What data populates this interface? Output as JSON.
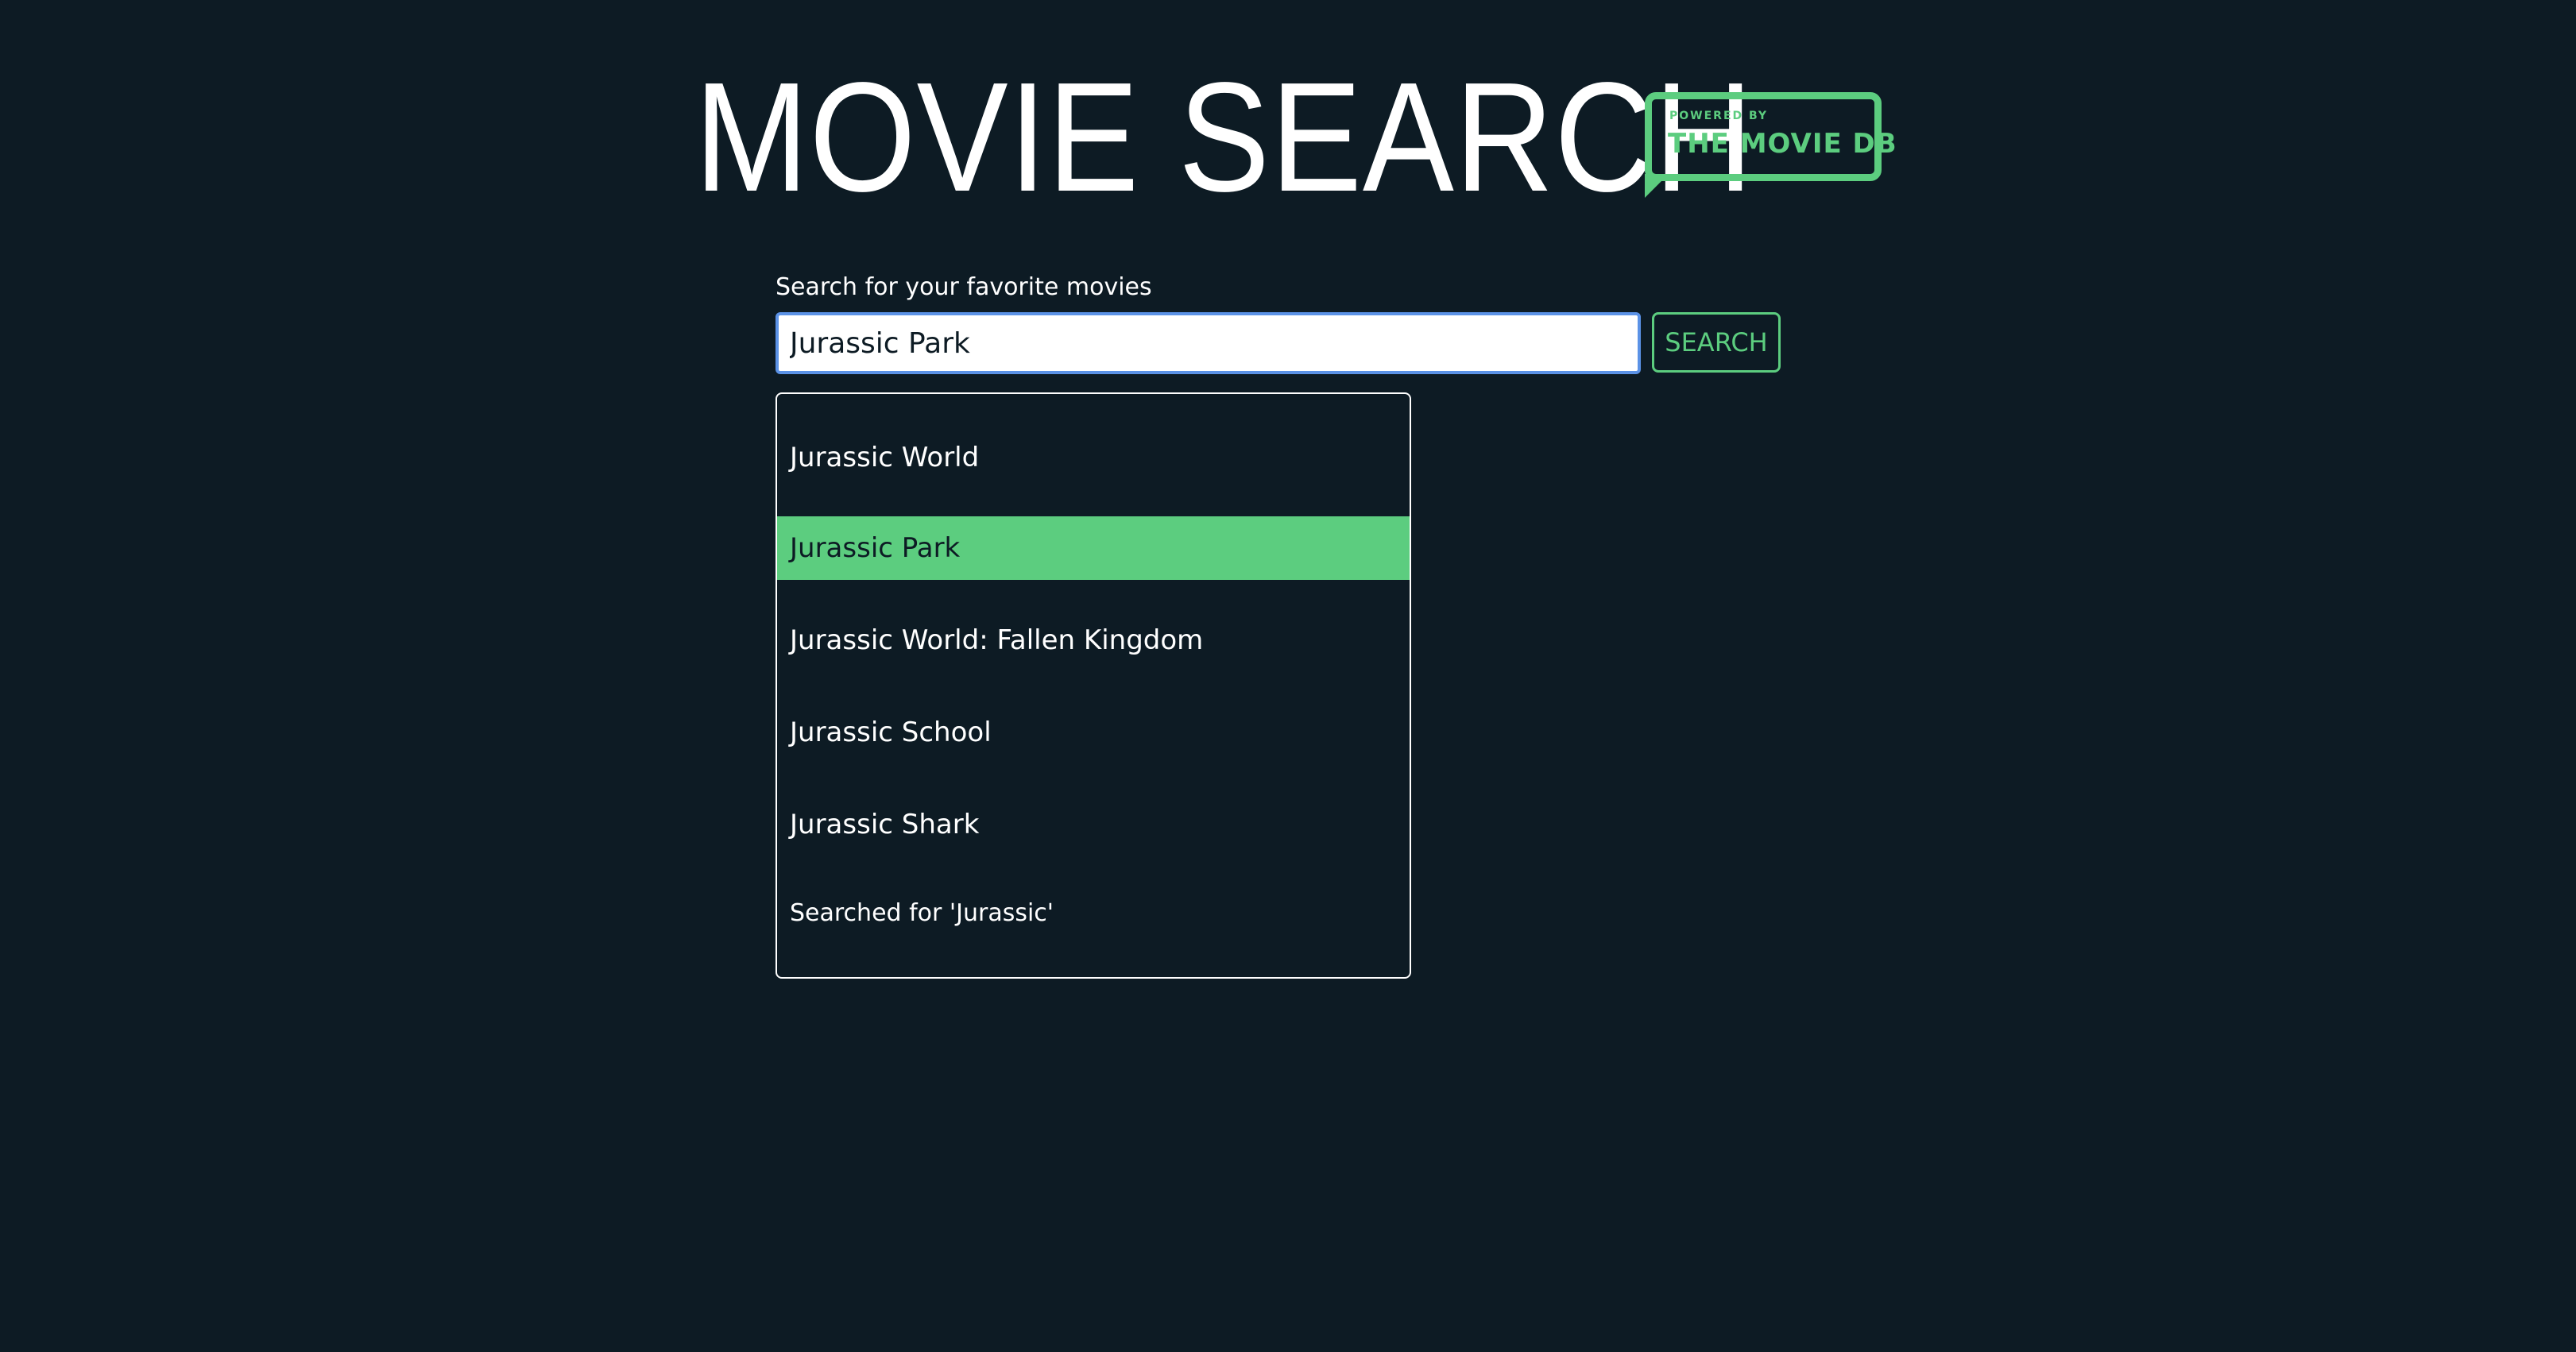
{
  "header": {
    "title": "MOVIE SEARCH",
    "badge": {
      "powered_by": "POWERED BY",
      "name": "THE MOVIE DB"
    }
  },
  "search": {
    "label": "Search for your favorite movies",
    "value": "Jurassic Park",
    "button_label": "SEARCH"
  },
  "suggestions": {
    "items": [
      {
        "label": "Jurassic World"
      },
      {
        "label": "Jurassic Park"
      },
      {
        "label": "Jurassic World: Fallen Kingdom"
      },
      {
        "label": "Jurassic School"
      },
      {
        "label": "Jurassic Shark"
      }
    ],
    "highlighted_item": "Jurassic Park",
    "searched_note": "Searched for 'Jurassic'"
  },
  "colors": {
    "background": "#0d1b24",
    "accent": "#5ccd7f",
    "input_focus": "#5b92e6"
  }
}
